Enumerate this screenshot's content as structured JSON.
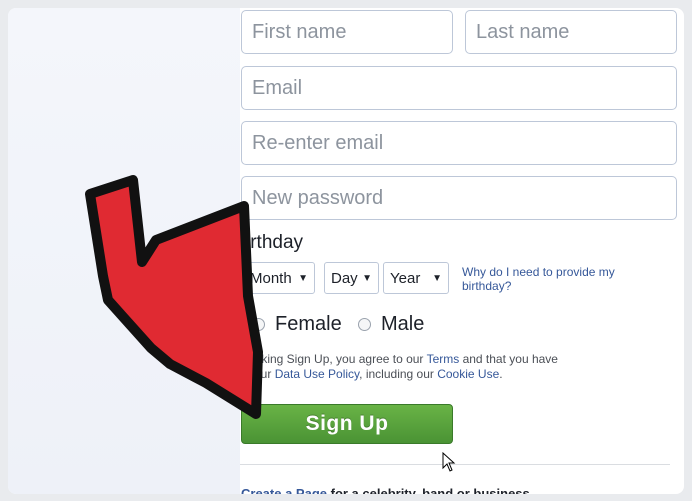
{
  "form": {
    "first_name_placeholder": "First name",
    "last_name_placeholder": "Last name",
    "email_placeholder": "Email",
    "reenter_email_placeholder": "Re-enter email",
    "password_placeholder": "New password",
    "birthday_label": "irthday",
    "month_label": "Month",
    "day_label": "Day",
    "year_label": "Year",
    "dropdown_caret": "▼",
    "why_birthday_link": "Why do I need to provide my birthday?",
    "gender_female": "Female",
    "gender_male": "Male",
    "terms_part1": "clicking Sign Up, you agree to our ",
    "terms_link": "Terms",
    "terms_part2": " and that you have",
    "terms_line2_prefix": "d our ",
    "data_policy_link": "Data Use Policy",
    "terms_line2_mid": ", including our ",
    "cookie_link": "Cookie Use",
    "terms_line2_end": ".",
    "signup_label": "Sign Up"
  },
  "footer": {
    "create_page_link": "Create a Page",
    "create_page_rest": " for a celebrity, band or business."
  },
  "colors": {
    "arrow_fill": "#e02a32",
    "signup_green": "#5aa33d",
    "link_blue": "#365899"
  },
  "icons": {
    "arrow": "red-pointer-arrow-icon",
    "cursor": "mouse-cursor-icon"
  }
}
